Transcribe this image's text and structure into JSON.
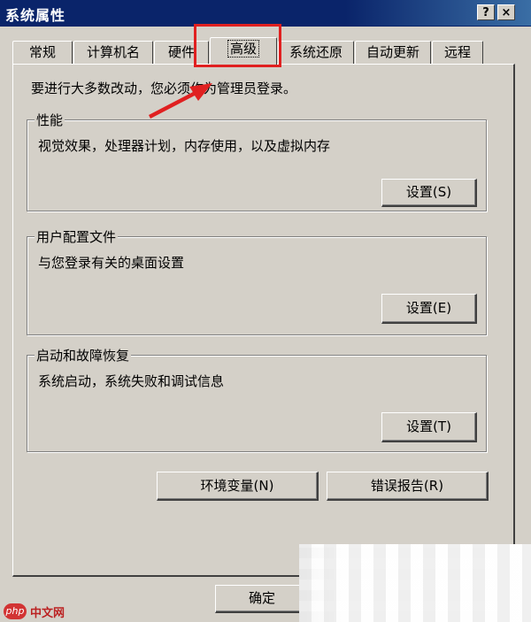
{
  "window": {
    "title": "系统属性",
    "help_btn": "?",
    "close_btn": "×"
  },
  "tabs": [
    "常规",
    "计算机名",
    "硬件",
    "高级",
    "系统还原",
    "自动更新",
    "远程"
  ],
  "notice": "要进行大多数改动，您必须作为管理员登录。",
  "groups": [
    {
      "title": "性能",
      "desc": "视觉效果，处理器计划，内存使用，以及虚拟内存",
      "button": "设置(S)"
    },
    {
      "title": "用户配置文件",
      "desc": "与您登录有关的桌面设置",
      "button": "设置(E)"
    },
    {
      "title": "启动和故障恢复",
      "desc": "系统启动，系统失败和调试信息",
      "button": "设置(T)"
    }
  ],
  "buttons": {
    "env_vars": "环境变量(N)",
    "error_report": "错误报告(R)",
    "ok": "确定"
  },
  "watermark": {
    "badge": "php",
    "text": "中文网"
  },
  "colors": {
    "highlight": "#e02020",
    "titlebar": "#0a246a"
  }
}
